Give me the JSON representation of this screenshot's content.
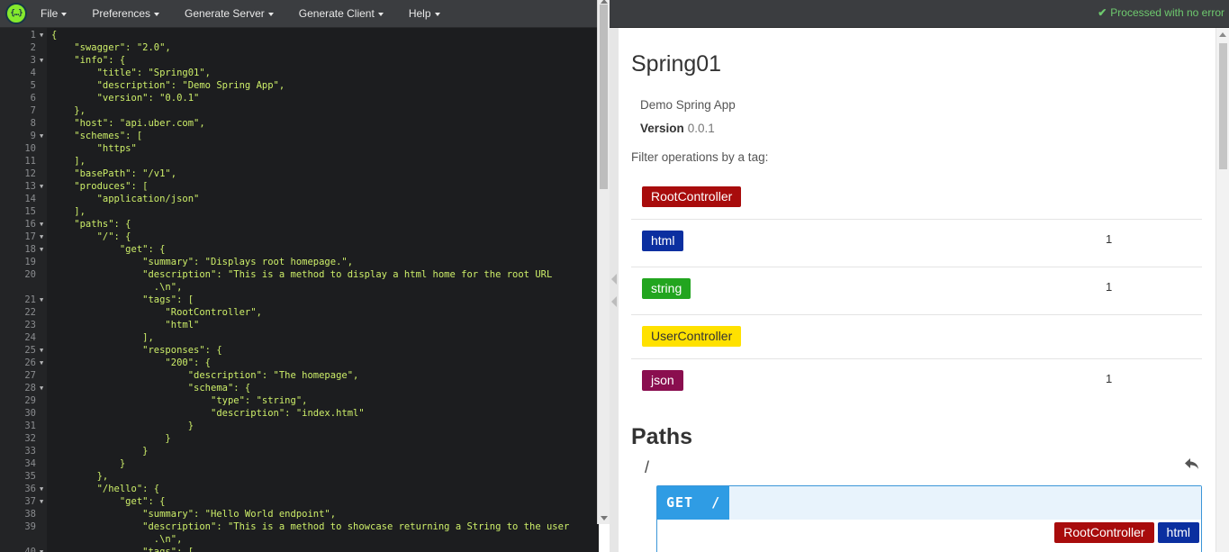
{
  "menu": {
    "items": [
      {
        "label": "File"
      },
      {
        "label": "Preferences"
      },
      {
        "label": "Generate Server"
      },
      {
        "label": "Generate Client"
      },
      {
        "label": "Help"
      }
    ],
    "logo_icon": "swagger-logo-icon",
    "status_text": "Processed with no error",
    "status_icon": "check-icon"
  },
  "editor": {
    "lines": [
      {
        "n": "1",
        "fold": true,
        "text": "{"
      },
      {
        "n": "2",
        "fold": false,
        "text": "    \"swagger\": \"2.0\","
      },
      {
        "n": "3",
        "fold": true,
        "text": "    \"info\": {"
      },
      {
        "n": "4",
        "fold": false,
        "text": "        \"title\": \"Spring01\","
      },
      {
        "n": "5",
        "fold": false,
        "text": "        \"description\": \"Demo Spring App\","
      },
      {
        "n": "6",
        "fold": false,
        "text": "        \"version\": \"0.0.1\""
      },
      {
        "n": "7",
        "fold": false,
        "text": "    },"
      },
      {
        "n": "8",
        "fold": false,
        "text": "    \"host\": \"api.uber.com\","
      },
      {
        "n": "9",
        "fold": true,
        "text": "    \"schemes\": ["
      },
      {
        "n": "10",
        "fold": false,
        "text": "        \"https\""
      },
      {
        "n": "11",
        "fold": false,
        "text": "    ],"
      },
      {
        "n": "12",
        "fold": false,
        "text": "    \"basePath\": \"/v1\","
      },
      {
        "n": "13",
        "fold": true,
        "text": "    \"produces\": ["
      },
      {
        "n": "14",
        "fold": false,
        "text": "        \"application/json\""
      },
      {
        "n": "15",
        "fold": false,
        "text": "    ],"
      },
      {
        "n": "16",
        "fold": true,
        "text": "    \"paths\": {"
      },
      {
        "n": "17",
        "fold": true,
        "text": "        \"/\": {"
      },
      {
        "n": "18",
        "fold": true,
        "text": "            \"get\": {"
      },
      {
        "n": "19",
        "fold": false,
        "text": "                \"summary\": \"Displays root homepage.\","
      },
      {
        "n": "20",
        "fold": false,
        "text": "                \"description\": \"This is a method to display a html home for the root URL"
      },
      {
        "n": "",
        "fold": false,
        "text": "                  .\\n\","
      },
      {
        "n": "21",
        "fold": true,
        "text": "                \"tags\": ["
      },
      {
        "n": "22",
        "fold": false,
        "text": "                    \"RootController\","
      },
      {
        "n": "23",
        "fold": false,
        "text": "                    \"html\""
      },
      {
        "n": "24",
        "fold": false,
        "text": "                ],"
      },
      {
        "n": "25",
        "fold": true,
        "text": "                \"responses\": {"
      },
      {
        "n": "26",
        "fold": true,
        "text": "                    \"200\": {"
      },
      {
        "n": "27",
        "fold": false,
        "text": "                        \"description\": \"The homepage\","
      },
      {
        "n": "28",
        "fold": true,
        "text": "                        \"schema\": {"
      },
      {
        "n": "29",
        "fold": false,
        "text": "                            \"type\": \"string\","
      },
      {
        "n": "30",
        "fold": false,
        "text": "                            \"description\": \"index.html\""
      },
      {
        "n": "31",
        "fold": false,
        "text": "                        }"
      },
      {
        "n": "32",
        "fold": false,
        "text": "                    }"
      },
      {
        "n": "33",
        "fold": false,
        "text": "                }"
      },
      {
        "n": "34",
        "fold": false,
        "text": "            }"
      },
      {
        "n": "35",
        "fold": false,
        "text": "        },"
      },
      {
        "n": "36",
        "fold": true,
        "text": "        \"/hello\": {"
      },
      {
        "n": "37",
        "fold": true,
        "text": "            \"get\": {"
      },
      {
        "n": "38",
        "fold": false,
        "text": "                \"summary\": \"Hello World endpoint\","
      },
      {
        "n": "39",
        "fold": false,
        "text": "                \"description\": \"This is a method to showcase returning a String to the user"
      },
      {
        "n": "",
        "fold": false,
        "text": "                  .\\n\","
      },
      {
        "n": "40",
        "fold": true,
        "text": "                \"tags\": ["
      }
    ]
  },
  "preview": {
    "title": "Spring01",
    "description": "Demo Spring App",
    "version_label": "Version",
    "version_value": "0.0.1",
    "filter_label": "Filter operations by a tag:",
    "tags": [
      {
        "name": "RootController",
        "count": "",
        "color": "#a80c0c"
      },
      {
        "name": "html",
        "count": "1",
        "color": "#0b2fa0"
      },
      {
        "name": "string",
        "count": "1",
        "color": "#22a51f"
      },
      {
        "name": "UserController",
        "count": "",
        "color": "#ffe100"
      },
      {
        "name": "json",
        "count": "1",
        "color": "#8a0e4f"
      }
    ],
    "paths_title": "Paths",
    "path": "/",
    "back_icon": "reply-arrow-icon",
    "operation": {
      "method": "GET",
      "path": "/",
      "tags": [
        {
          "name": "RootController",
          "color": "#a80c0c"
        },
        {
          "name": "html",
          "color": "#0b2fa0"
        }
      ]
    }
  }
}
